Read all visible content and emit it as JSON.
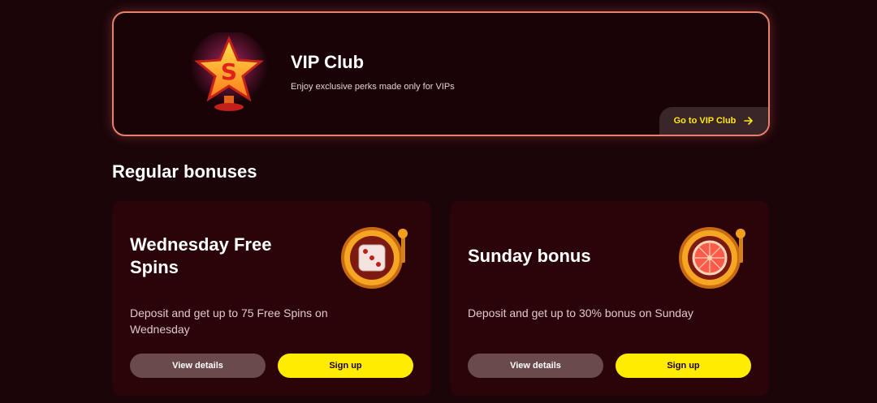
{
  "vip": {
    "title": "VIP Club",
    "subtitle": "Enjoy exclusive perks made only for VIPs",
    "cta_label": "Go to VIP Club",
    "icon": "star-trophy-icon"
  },
  "section": {
    "title": "Regular bonuses"
  },
  "bonuses": [
    {
      "title": "Wednesday Free Spins",
      "description": "Deposit and get up to 75 Free Spins on Wednesday",
      "details_label": "View details",
      "signup_label": "Sign up",
      "icon": "dice-slot-icon"
    },
    {
      "title": "Sunday bonus",
      "description": "Deposit and get up to 30% bonus on Sunday",
      "details_label": "View details",
      "signup_label": "Sign up",
      "icon": "grapefruit-slot-icon"
    }
  ],
  "colors": {
    "background": "#1b0509",
    "accent_yellow": "#ffec00",
    "card_border": "#e8806e",
    "card_bg": "#2a0409"
  }
}
